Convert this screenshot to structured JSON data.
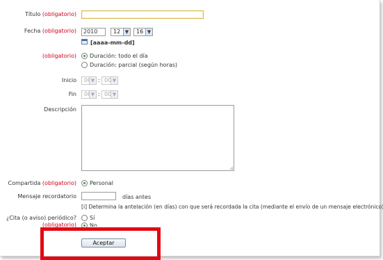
{
  "required_text": "(obligatorio)",
  "title": {
    "label": "Título",
    "value": ""
  },
  "date": {
    "label": "Fecha",
    "year": "2010",
    "month": "12",
    "day": "16",
    "format_hint": "[aaaa-mm-dd]"
  },
  "duration": {
    "options": [
      {
        "label": "Duración: todo el día",
        "selected": true
      },
      {
        "label": "Duración: parcial (según horas)",
        "selected": false
      }
    ]
  },
  "start": {
    "label": "Inicio",
    "hour": "00",
    "minute": "00",
    "separator": ":"
  },
  "end": {
    "label": "Fin",
    "hour": "00",
    "minute": "00",
    "separator": ":"
  },
  "description": {
    "label": "Descripción",
    "value": ""
  },
  "shared": {
    "label": "Compartida",
    "option": "Personal"
  },
  "reminder": {
    "label": "Mensaje recordatorio",
    "value": "",
    "suffix": "días antes",
    "note": "[i] Determina la antelación (en días) con que será recordada la cita (mediante el envío de un mensaje electrónico)."
  },
  "periodic": {
    "label": "¿Cita (o aviso) periódico?",
    "option_yes": "Sí",
    "option_no": "No"
  },
  "submit": {
    "label": "Aceptar"
  },
  "colors": {
    "required": "#d0021b",
    "highlight_box": "#e30613"
  }
}
